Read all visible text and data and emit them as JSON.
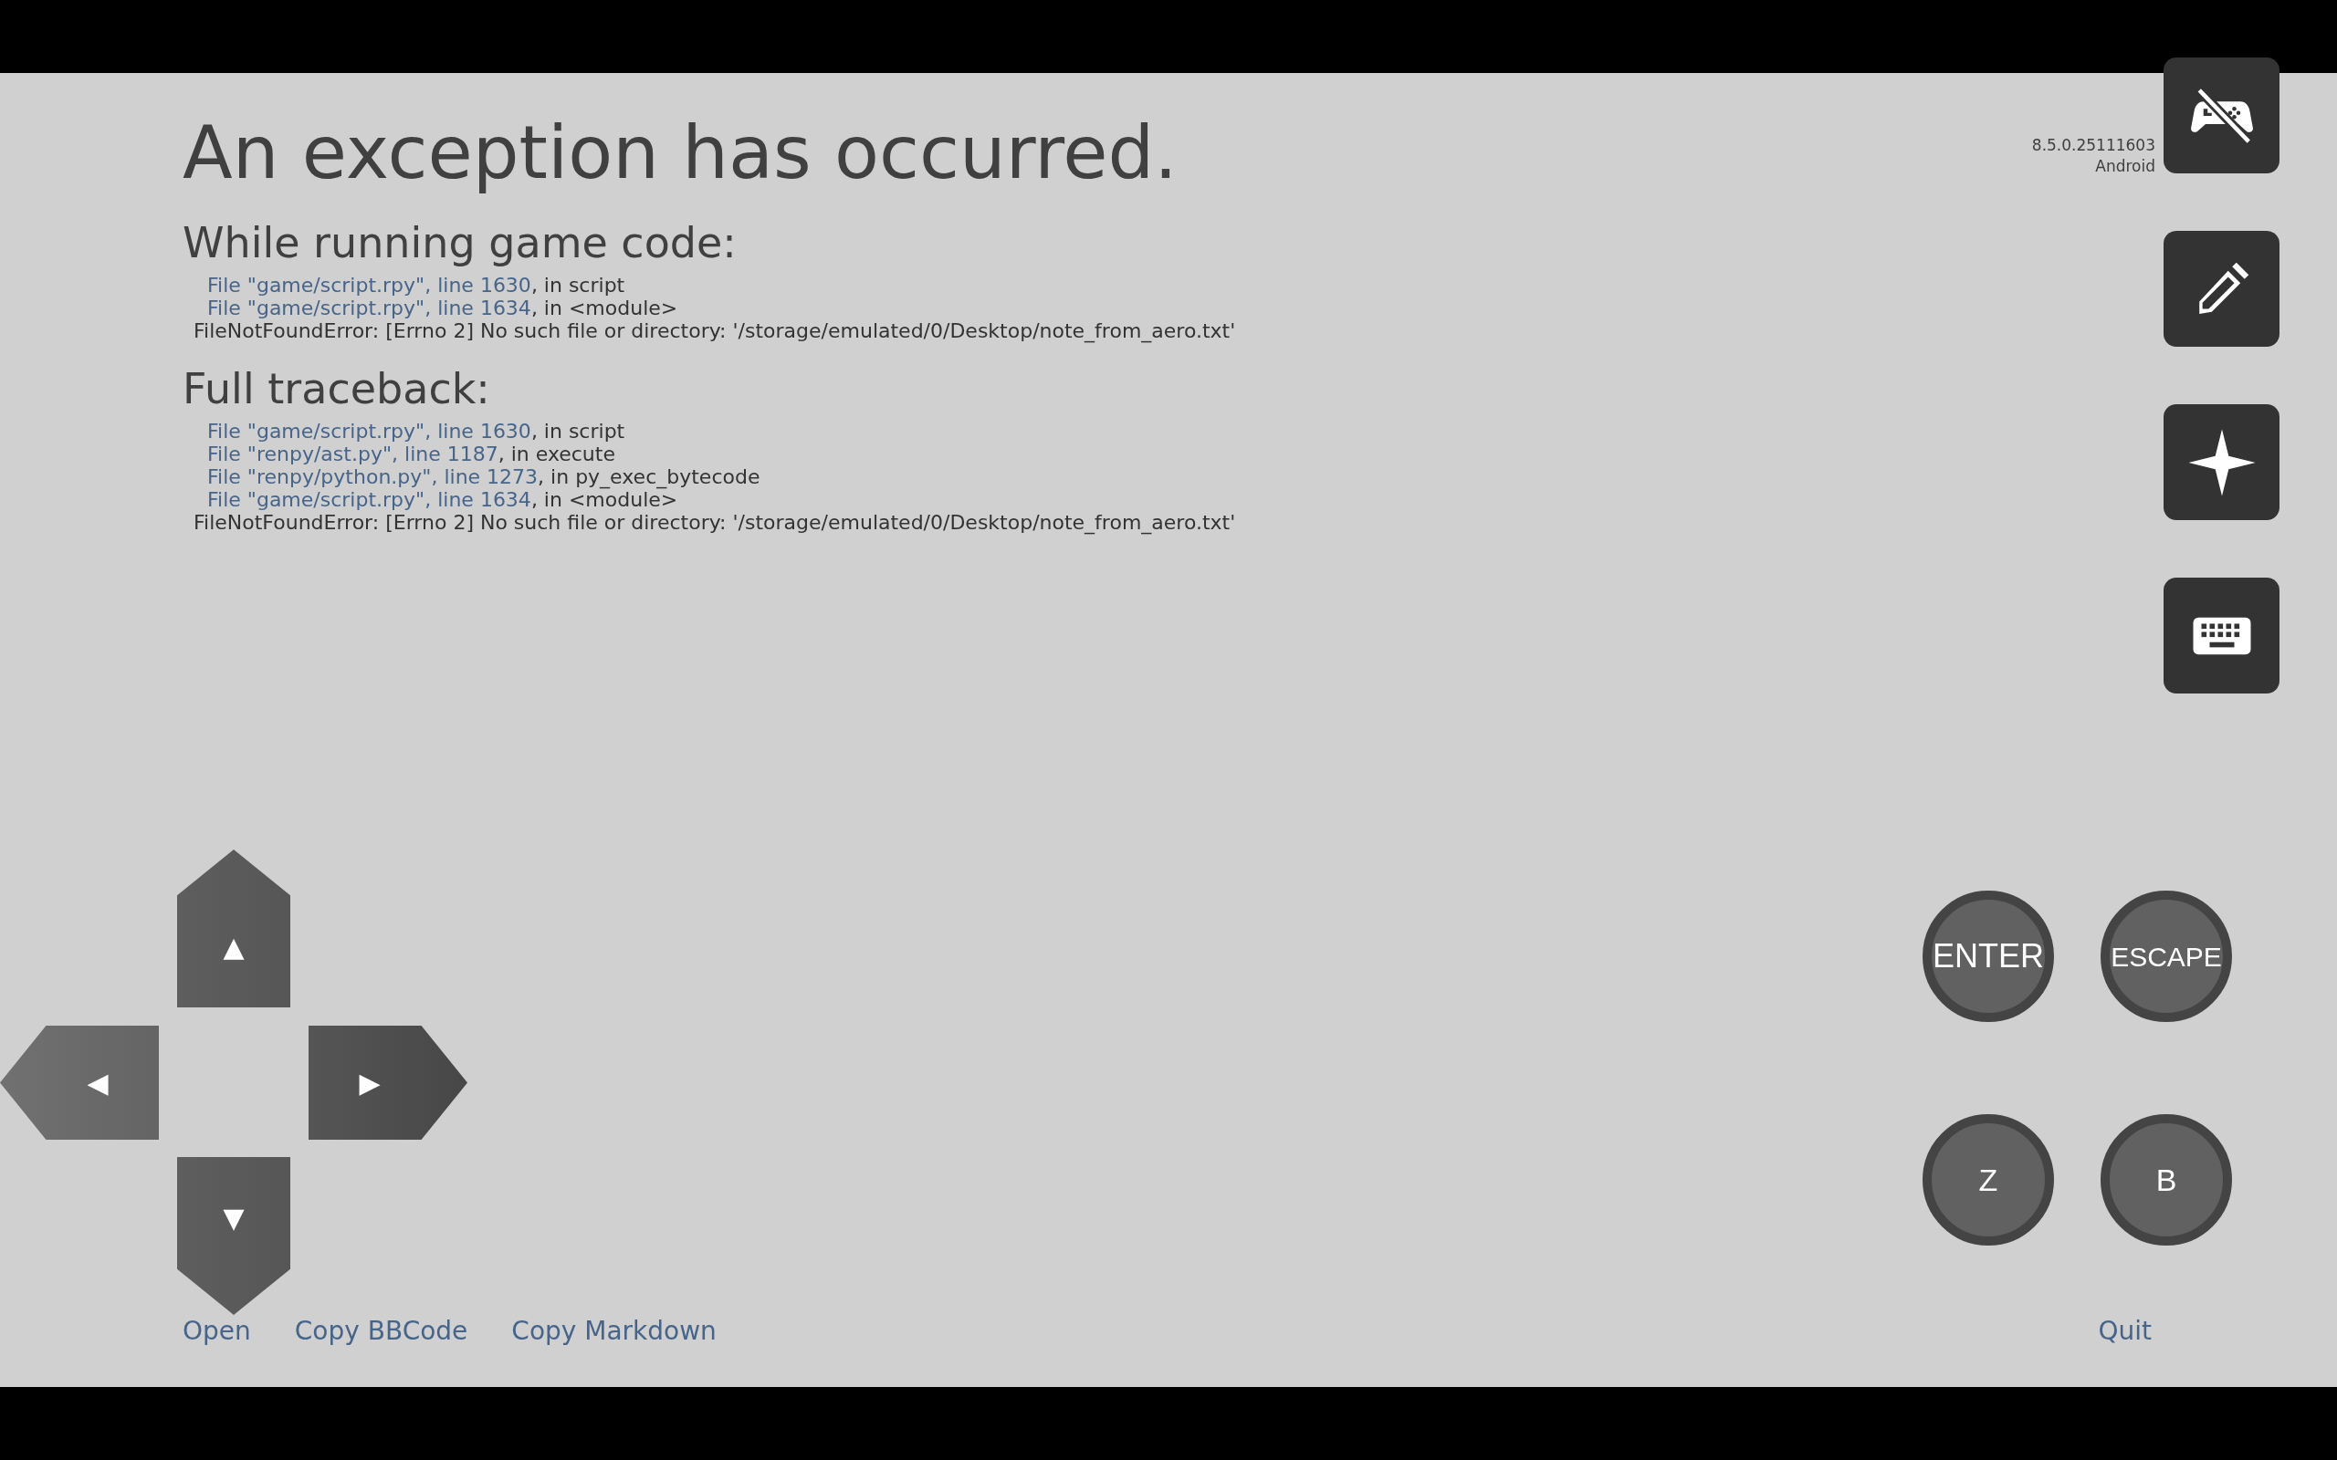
{
  "title": "An exception has occurred.",
  "version": [
    "8.5.0.25111603",
    "Android"
  ],
  "sections": [
    {
      "heading": "While running game code:",
      "frames": [
        {
          "location": "File \"game/script.rpy\", line 1630",
          "rest": ", in script"
        },
        {
          "location": "File \"game/script.rpy\", line 1634",
          "rest": ", in <module>"
        }
      ],
      "error": "FileNotFoundError: [Errno 2] No such file or directory: '/storage/emulated/0/Desktop/note_from_aero.txt'"
    },
    {
      "heading": "Full traceback:",
      "frames": [
        {
          "location": "File \"game/script.rpy\", line 1630",
          "rest": ", in script"
        },
        {
          "location": "File \"renpy/ast.py\", line 1187",
          "rest": ", in execute"
        },
        {
          "location": "File \"renpy/python.py\", line 1273",
          "rest": ", in py_exec_bytecode"
        },
        {
          "location": "File \"game/script.rpy\", line 1634",
          "rest": ", in <module>"
        }
      ],
      "error": "FileNotFoundError: [Errno 2] No such file or directory: '/storage/emulated/0/Desktop/note_from_aero.txt'"
    }
  ],
  "actions": [
    "Open",
    "Copy BBCode",
    "Copy Markdown"
  ],
  "quit": "Quit",
  "side_buttons": [
    {
      "kind": "gamepad-off"
    },
    {
      "kind": "pencil"
    },
    {
      "kind": "sparkle"
    },
    {
      "kind": "keyboard"
    }
  ],
  "dpad": [
    {
      "kind": "up",
      "glyph": "▲"
    },
    {
      "kind": "left",
      "glyph": "◀"
    },
    {
      "kind": "right",
      "glyph": "▶"
    },
    {
      "kind": "down",
      "glyph": "▼"
    }
  ],
  "round_buttons": [
    "ENTER",
    "ESCAPE",
    "Z",
    "B"
  ]
}
